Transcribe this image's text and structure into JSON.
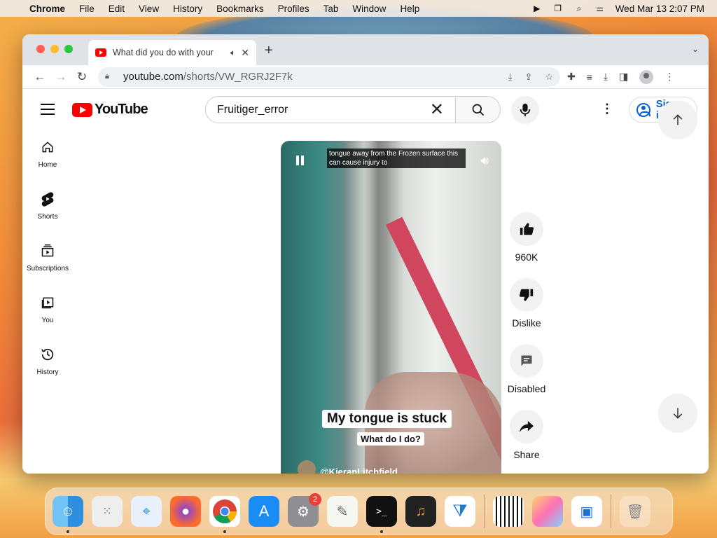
{
  "menubar": {
    "app": "Chrome",
    "menus": [
      "File",
      "Edit",
      "View",
      "History",
      "Bookmarks",
      "Profiles",
      "Tab",
      "Window",
      "Help"
    ],
    "datetime": "Wed Mar 13  2:07 PM"
  },
  "browser": {
    "tab_title": "What did you do with your",
    "url_host": "youtube.com",
    "url_path": "/shorts/VW_RGRJ2F7k"
  },
  "youtube": {
    "logo_text": "YouTube",
    "search_value": "Fruitiger_error",
    "sign_in": "Sign in",
    "guide": [
      {
        "label": "Home",
        "icon": "home-icon"
      },
      {
        "label": "Shorts",
        "icon": "shorts-icon"
      },
      {
        "label": "Subscriptions",
        "icon": "subscriptions-icon"
      },
      {
        "label": "You",
        "icon": "you-icon"
      },
      {
        "label": "History",
        "icon": "history-icon"
      }
    ],
    "player": {
      "closed_caption": "tongue away from the Frozen surface this can cause injury to",
      "caption_main": "My tongue is stuck",
      "caption_sub": "What do I do?",
      "channel": "@KieranLitchfield"
    },
    "actions": {
      "like_count": "960K",
      "dislike": "Dislike",
      "comments": "Disabled",
      "share": "Share"
    }
  },
  "dock": {
    "apps": [
      "Finder",
      "Launchpad",
      "Safari",
      "Firefox",
      "Chrome",
      "App Store",
      "System Settings",
      "TextEdit",
      "Terminal",
      "GarageBand",
      "Visual Studio Code",
      "Piano",
      "Pages",
      "Remote Desktop",
      "Trash"
    ],
    "settings_badge": "2"
  },
  "colors": {
    "youtube_red": "#ff0000",
    "link_blue": "#065fd4"
  }
}
